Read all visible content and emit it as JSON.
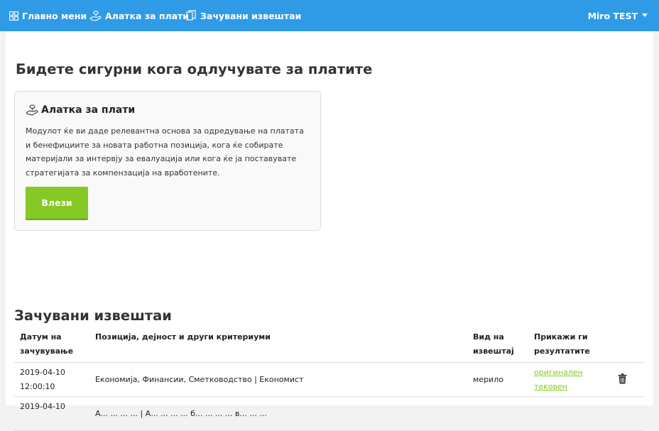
{
  "nav": {
    "home": "Главно мени",
    "pay_tool": "Алатка за плати",
    "saved_reports": "Зачувани извештаи",
    "user": "Miro TEST"
  },
  "main": {
    "title": "Бидете сигурни кога одлучувате за платите",
    "card": {
      "title": "Алатка за плати",
      "description": "Модулот ќе ви даде релевантна основа за одредување на платата и бенефициите за новата работна позиција, кога ќе собирате материјали за интервју за евалуација или кога ќе ја поставувате стратегијата за компензација на вработените.",
      "button": "Влези"
    }
  },
  "reports": {
    "title": "Зачувани извештаи",
    "headers": {
      "date": "Датум на зачувување",
      "position": "Позиција, дејност и други критериуми",
      "type": "Вид на извештај",
      "show": "Прикажи ги резултатите"
    },
    "rows": [
      {
        "date": "2019-04-10",
        "time": "12:00:10",
        "position": "Економија, Финансии, Сметководство | Економист",
        "type": "мерило",
        "link1": "оригинален",
        "link2": "тековен"
      },
      {
        "date": "2019-04-10",
        "time": "",
        "position": "А... ... ... ... | А... ... ... ... б... ... ... ... в... ... ...",
        "type": "",
        "link1": "",
        "link2": ""
      }
    ]
  },
  "colors": {
    "nav_bg": "#2f9be6",
    "accent_green": "#86c826",
    "page_bg": "#f2f2f2"
  },
  "icons": {
    "home": "grid-icon",
    "pay_tool": "hand-coin-icon",
    "saved_reports": "copy-icon",
    "user": "caret-down-icon",
    "delete": "trash-icon"
  }
}
